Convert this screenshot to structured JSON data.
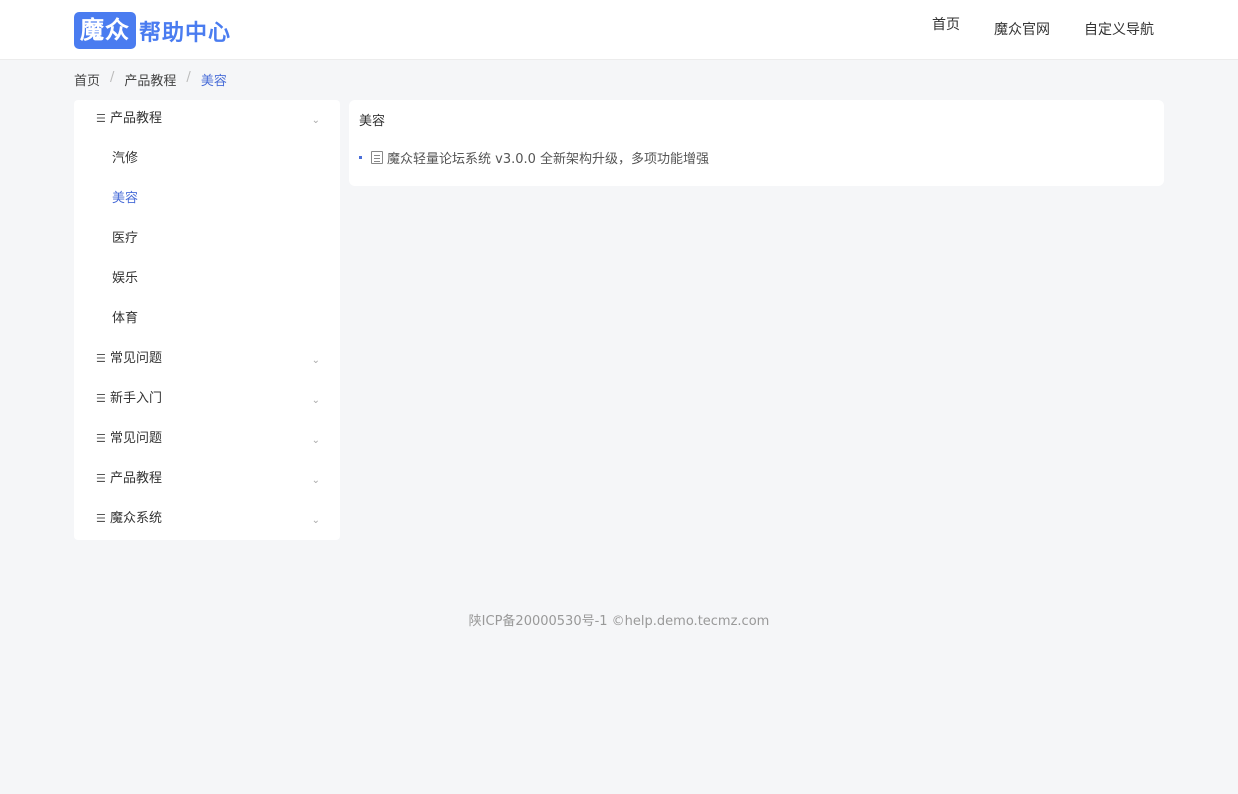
{
  "header": {
    "logo_mark": "魔众",
    "logo_text": "帮助中心",
    "nav": [
      "首页",
      "魔众官网",
      "自定义导航"
    ]
  },
  "breadcrumb": {
    "items": [
      "首页",
      "产品教程",
      "美容"
    ],
    "separator": "/"
  },
  "sidebar": {
    "groups": [
      {
        "label": "产品教程",
        "expanded": true,
        "children": [
          {
            "label": "汽修"
          },
          {
            "label": "美容",
            "active": true
          },
          {
            "label": "医疗"
          },
          {
            "label": "娱乐"
          },
          {
            "label": "体育"
          }
        ]
      },
      {
        "label": "常见问题"
      },
      {
        "label": "新手入门"
      },
      {
        "label": "常见问题"
      },
      {
        "label": "产品教程"
      },
      {
        "label": "魔众系统"
      }
    ]
  },
  "main": {
    "title": "美容",
    "articles": [
      "魔众轻量论坛系统 v3.0.0 全新架构升级，多项功能增强"
    ]
  },
  "footer": {
    "text": "陕ICP备20000530号-1 ©help.demo.tecmz.com"
  },
  "colors": {
    "accent": "#4a7cf0",
    "active": "#4a6ed8",
    "background": "#f5f6f8"
  },
  "icons": {
    "group_icon": "list-icon",
    "chevron": "chevron-down-icon",
    "article": "document-icon"
  }
}
